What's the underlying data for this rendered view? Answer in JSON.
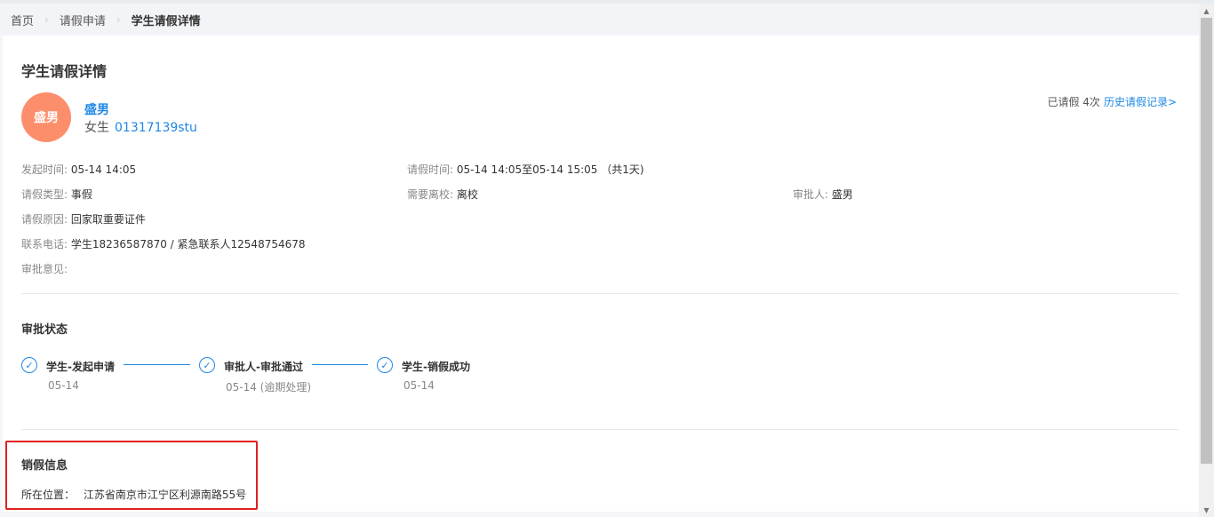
{
  "breadcrumb": {
    "items": [
      "首页",
      "请假申请",
      "学生请假详情"
    ]
  },
  "page": {
    "title": "学生请假详情"
  },
  "student": {
    "avatar_text": "盛男",
    "name": "盛男",
    "gender": "女生",
    "id": "01317139stu"
  },
  "leave_count": {
    "text": "已请假 4次",
    "history_link": "历史请假记录>"
  },
  "details": {
    "start_time_label": "发起时间:",
    "start_time": "05-14 14:05",
    "leave_time_label": "请假时间:",
    "leave_time": "05-14 14:05至05-14 15:05  （共1天)",
    "type_label": "请假类型:",
    "type": "事假",
    "leave_school_label": "需要离校:",
    "leave_school": "离校",
    "approver_label": "审批人:",
    "approver": "盛男",
    "reason_label": "请假原因:",
    "reason": "回家取重要证件",
    "phone_label": "联系电话:",
    "phone": "学生18236587870 /  紧急联系人12548754678",
    "opinion_label": "审批意见:",
    "opinion": ""
  },
  "approval_status": {
    "title": "审批状态",
    "steps": [
      {
        "label": "学生-发起申请",
        "date": "05-14"
      },
      {
        "label": "审批人-审批通过",
        "date": "05-14 (逾期处理)"
      },
      {
        "label": "学生-销假成功",
        "date": "05-14"
      }
    ]
  },
  "cancel_leave": {
    "title": "销假信息",
    "location_label": "所在位置：",
    "location": "江苏省南京市江宁区利源南路55号"
  },
  "colors": {
    "accent": "#1e88e5",
    "avatar_bg": "#fd8e6c",
    "highlight": "#e02020"
  },
  "icons": {
    "step_icon": "check-circle-icon",
    "separator": "chevron-right-icon"
  }
}
